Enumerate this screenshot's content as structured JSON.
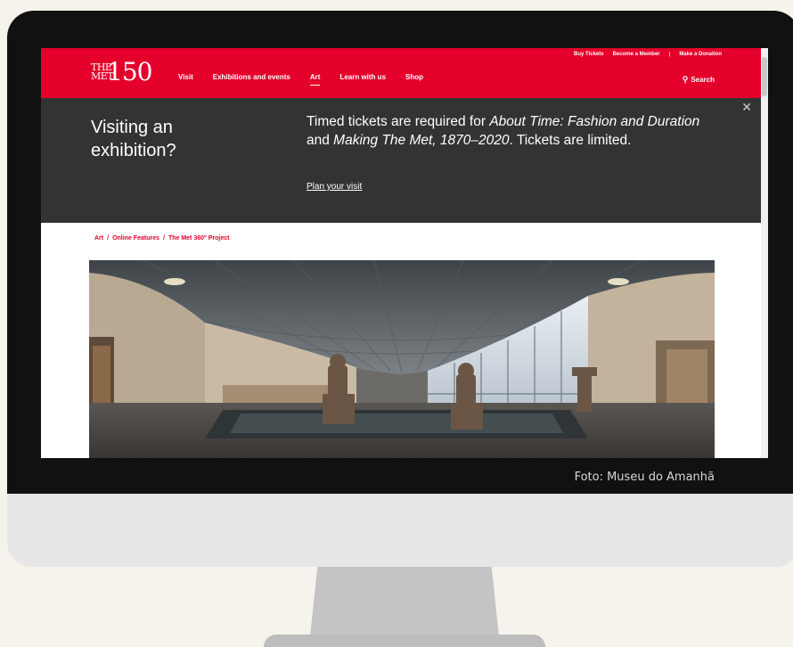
{
  "nav": {
    "logo_the_met": "THE MET",
    "logo_number": "150",
    "items": [
      {
        "label": "Visit"
      },
      {
        "label": "Exhibitions and events"
      },
      {
        "label": "Art"
      },
      {
        "label": "Learn with us"
      },
      {
        "label": "Shop"
      }
    ],
    "active_item": "Art",
    "utility_links": [
      {
        "label": "Buy Tickets"
      },
      {
        "label": "Become a Member"
      },
      {
        "label": "Make a Donation"
      }
    ],
    "search_label": "Search"
  },
  "banner": {
    "heading": "Visiting an exhibition?",
    "text_part1": "Timed tickets are required for ",
    "text_em1": "About Time: Fashion and Duration",
    "text_part2": " and ",
    "text_em2": "Making The Met, 1870–2020",
    "text_part3": ". Tickets are limited.",
    "link_label": "Plan your visit"
  },
  "breadcrumb": [
    "Art",
    "Online Features",
    "The Met 360° Project"
  ],
  "breadcrumb_separator": "/",
  "caption": "Foto: Museu do Amanhã",
  "colors": {
    "brand_red": "#e4002b",
    "banner_bg": "#333333"
  }
}
